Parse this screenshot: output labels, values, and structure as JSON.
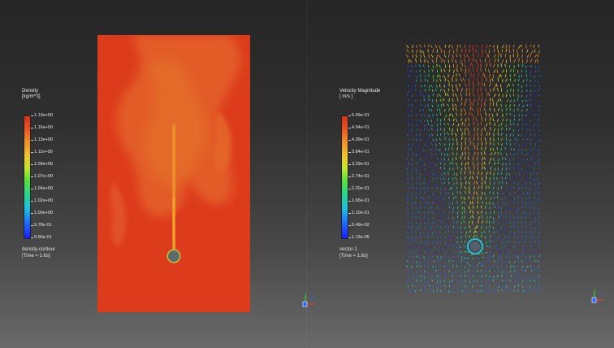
{
  "left_view": {
    "legend": {
      "title_line1": "Density",
      "title_line2": "[kg/m^3]",
      "ticks": [
        "1.19e+00",
        "1.16e+00",
        "1.13e+00",
        "1.11e+00",
        "1.09e+00",
        "1.07e+00",
        "1.04e+00",
        "1.02e+00",
        "1.00e+00",
        "9.78e-01",
        "9.56e-01"
      ],
      "caption_line1": "density-contour",
      "caption_line2": "[Time = 1.6s]"
    },
    "field": "density contour",
    "background_color": "#dd3e1c",
    "plume_color": "#e8752a"
  },
  "right_view": {
    "legend": {
      "title_line1": "Velocity Magnitude",
      "title_line2": "[ m/s ]",
      "ticks": [
        "5.49e-01",
        "4.94e-01",
        "4.39e-01",
        "3.84e-01",
        "3.29e-01",
        "2.74e-01",
        "2.20e-01",
        "1.65e-01",
        "1.10e-01",
        "5.49e-02",
        "1.13e-05"
      ],
      "caption_line1": "vector-1",
      "caption_line2": "[Time = 1.6s]"
    },
    "field": "velocity vectors"
  },
  "axis_triad": {
    "icon": "xyz-axis-triad-icon",
    "x_color": "#ff3030",
    "y_color": "#30e030",
    "z_color": "#3060ff"
  },
  "colormap": [
    "#1b1bff",
    "#1a6bff",
    "#1fbfe0",
    "#24d68c",
    "#5fe03a",
    "#c8e52a",
    "#f2c22a",
    "#f08a25",
    "#e8521f",
    "#d9301c"
  ]
}
